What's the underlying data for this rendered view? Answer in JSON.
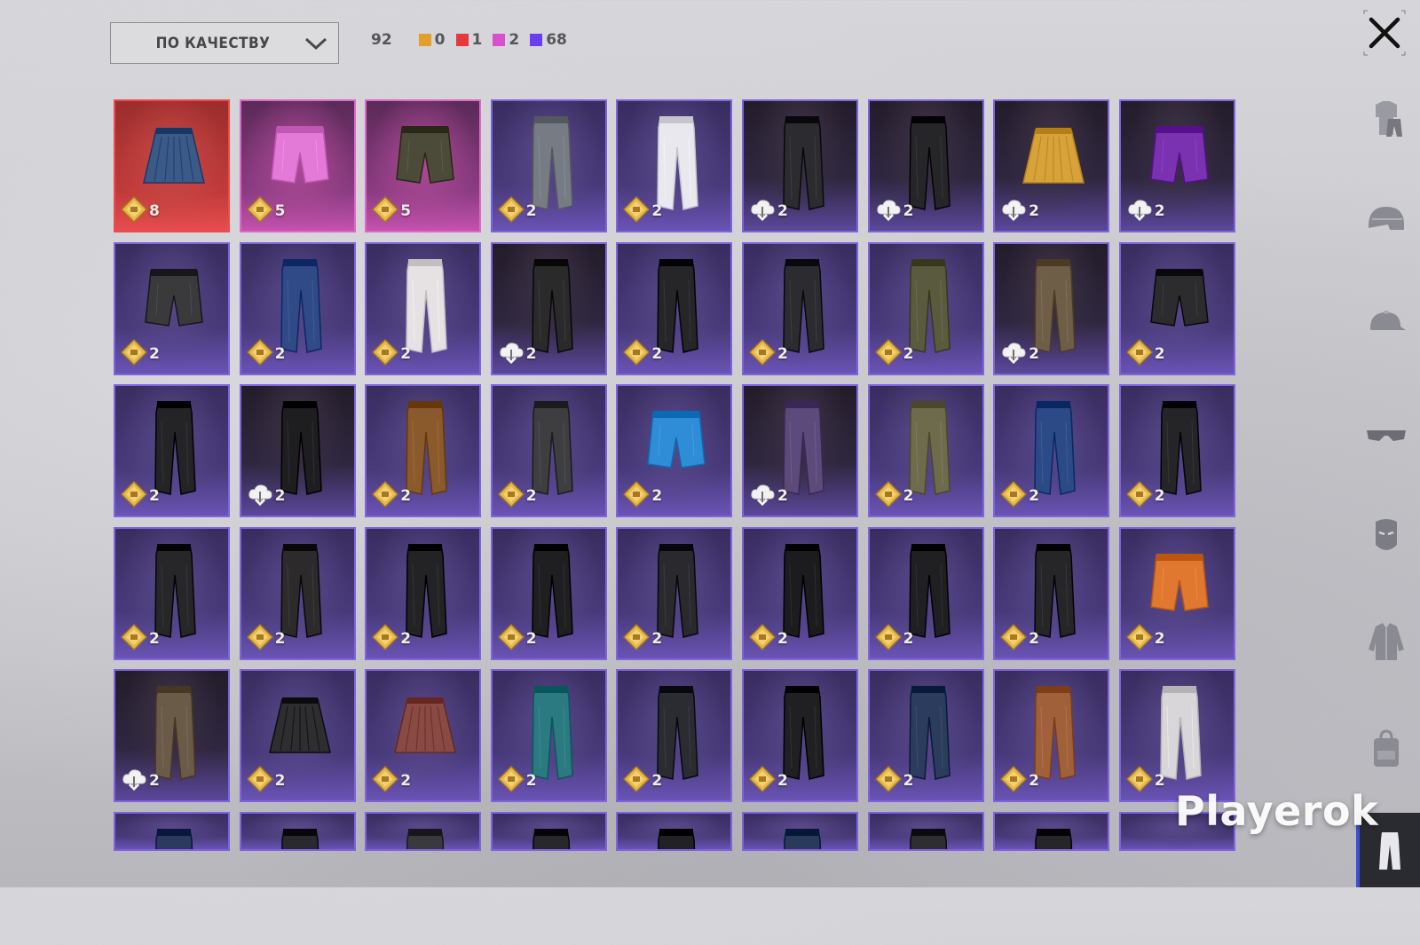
{
  "sort": {
    "label": "ПО КАЧЕСТВУ"
  },
  "counts": {
    "total": "92",
    "groups": [
      {
        "color": "#e0a02a",
        "value": "0"
      },
      {
        "color": "#e8383c",
        "value": "1"
      },
      {
        "color": "#d84fd0",
        "value": "2"
      },
      {
        "color": "#6b3df0",
        "value": "68"
      }
    ]
  },
  "items": [
    {
      "name": "denim-pleated-skirt",
      "tier": "red",
      "icon": "bp-coin",
      "value": "8",
      "kind": "skirt",
      "color": "#3c5a88"
    },
    {
      "name": "pink-shorts",
      "tier": "pink",
      "icon": "bp-coin",
      "value": "5",
      "kind": "shorts",
      "color": "#e47ad8"
    },
    {
      "name": "camo-shorts",
      "tier": "pink",
      "icon": "bp-coin",
      "value": "5",
      "kind": "shorts",
      "color": "#4c4a38"
    },
    {
      "name": "grey-cargo-pants",
      "tier": "purple",
      "icon": "bp-coin",
      "value": "2",
      "kind": "pants",
      "color": "#777b83"
    },
    {
      "name": "white-flared-pants",
      "tier": "purple",
      "icon": "bp-coin",
      "value": "2",
      "kind": "pants",
      "color": "#e8e8ee"
    },
    {
      "name": "dark-strapped-pants",
      "tier": "dark",
      "icon": "cloud-download",
      "value": "2",
      "kind": "pants",
      "color": "#2c2c30"
    },
    {
      "name": "black-moto-pants",
      "tier": "dark",
      "icon": "cloud-download",
      "value": "2",
      "kind": "pants",
      "color": "#262629"
    },
    {
      "name": "yellow-plaid-skirt",
      "tier": "dark",
      "icon": "cloud-download",
      "value": "2",
      "kind": "skirt",
      "color": "#d8a23a"
    },
    {
      "name": "purple-lace-shorts",
      "tier": "dark",
      "icon": "cloud-download",
      "value": "2",
      "kind": "shorts",
      "color": "#7a32b0"
    },
    {
      "name": "black-torn-shorts",
      "tier": "purple",
      "icon": "bp-coin",
      "value": "2",
      "kind": "shorts",
      "color": "#3a3a3c"
    },
    {
      "name": "blue-ripped-jeans",
      "tier": "purple",
      "icon": "bp-coin",
      "value": "2",
      "kind": "pants",
      "color": "#2f4a86"
    },
    {
      "name": "white-patterned-leggings",
      "tier": "purple",
      "icon": "bp-coin",
      "value": "2",
      "kind": "pants",
      "color": "#e6e2e4"
    },
    {
      "name": "black-belt-pants",
      "tier": "dark",
      "icon": "cloud-download",
      "value": "2",
      "kind": "pants",
      "color": "#2a2a2b"
    },
    {
      "name": "black-joggers",
      "tier": "purple",
      "icon": "bp-coin",
      "value": "2",
      "kind": "pants",
      "color": "#262628"
    },
    {
      "name": "red-strap-pants",
      "tier": "purple",
      "icon": "bp-coin",
      "value": "2",
      "kind": "pants",
      "color": "#2b2b30"
    },
    {
      "name": "olive-cargo-pants",
      "tier": "purple",
      "icon": "bp-coin",
      "value": "2",
      "kind": "pants",
      "color": "#5a5a3e"
    },
    {
      "name": "camo-slim-pants",
      "tier": "dark",
      "icon": "cloud-download",
      "value": "2",
      "kind": "pants",
      "color": "#6e5e48"
    },
    {
      "name": "black-shorts-with-boots",
      "tier": "purple",
      "icon": "bp-coin",
      "value": "2",
      "kind": "shorts",
      "color": "#2c2c2e"
    },
    {
      "name": "black-jodhpurs",
      "tier": "purple",
      "icon": "bp-coin",
      "value": "2",
      "kind": "pants",
      "color": "#242426"
    },
    {
      "name": "black-strap-pants",
      "tier": "dark",
      "icon": "cloud-download",
      "value": "2",
      "kind": "pants",
      "color": "#1e1e20"
    },
    {
      "name": "bronze-leather-pants",
      "tier": "purple",
      "icon": "bp-coin",
      "value": "2",
      "kind": "pants",
      "color": "#8a5a2c"
    },
    {
      "name": "digital-camo-pants",
      "tier": "purple",
      "icon": "bp-coin",
      "value": "2",
      "kind": "pants",
      "color": "#3e3e40"
    },
    {
      "name": "blue-yellow-shorts",
      "tier": "purple",
      "icon": "bp-coin",
      "value": "2",
      "kind": "shorts",
      "color": "#2f8cd6"
    },
    {
      "name": "argyle-pants",
      "tier": "dark",
      "icon": "cloud-download",
      "value": "2",
      "kind": "pants",
      "color": "#5c4a7a"
    },
    {
      "name": "khaki-pants",
      "tier": "purple",
      "icon": "bp-coin",
      "value": "2",
      "kind": "pants",
      "color": "#6e6a4c"
    },
    {
      "name": "blue-jeans-pink-wrap",
      "tier": "purple",
      "icon": "bp-coin",
      "value": "2",
      "kind": "pants",
      "color": "#2c4b86"
    },
    {
      "name": "black-graffiti-pants",
      "tier": "purple",
      "icon": "bp-coin",
      "value": "2",
      "kind": "pants",
      "color": "#252527"
    },
    {
      "name": "black-tactical-pants",
      "tier": "purple",
      "icon": "bp-coin",
      "value": "2",
      "kind": "pants",
      "color": "#27272a"
    },
    {
      "name": "black-red-stitch-pants",
      "tier": "purple",
      "icon": "bp-coin",
      "value": "2",
      "kind": "pants",
      "color": "#2d2a2c"
    },
    {
      "name": "black-red-stripe-pants",
      "tier": "purple",
      "icon": "bp-coin",
      "value": "2",
      "kind": "pants",
      "color": "#232326"
    },
    {
      "name": "black-red-belt-pants",
      "tier": "purple",
      "icon": "bp-coin",
      "value": "2",
      "kind": "pants",
      "color": "#1f1f21"
    },
    {
      "name": "black-blue-patch-pants",
      "tier": "purple",
      "icon": "bp-coin",
      "value": "2",
      "kind": "pants",
      "color": "#2a2a2e"
    },
    {
      "name": "black-track-pants",
      "tier": "purple",
      "icon": "bp-coin",
      "value": "2",
      "kind": "pants",
      "color": "#1c1c1e"
    },
    {
      "name": "black-neon-pants",
      "tier": "purple",
      "icon": "bp-coin",
      "value": "2",
      "kind": "pants",
      "color": "#202023"
    },
    {
      "name": "black-asym-pants",
      "tier": "purple",
      "icon": "bp-coin",
      "value": "2",
      "kind": "pants",
      "color": "#262628"
    },
    {
      "name": "orange-floral-shorts",
      "tier": "purple",
      "icon": "bp-coin",
      "value": "2",
      "kind": "shorts",
      "color": "#e07830"
    },
    {
      "name": "two-tone-pants",
      "tier": "dark",
      "icon": "cloud-download",
      "value": "2",
      "kind": "pants",
      "color": "#6a5a48"
    },
    {
      "name": "black-leather-skirt",
      "tier": "purple",
      "icon": "bp-coin",
      "value": "2",
      "kind": "skirt",
      "color": "#2e2e30"
    },
    {
      "name": "red-plaid-skirt",
      "tier": "purple",
      "icon": "bp-coin",
      "value": "2",
      "kind": "skirt",
      "color": "#8a4a44"
    },
    {
      "name": "teal-jeans",
      "tier": "purple",
      "icon": "bp-coin",
      "value": "2",
      "kind": "pants",
      "color": "#2a7a80"
    },
    {
      "name": "dark-biker-jeans",
      "tier": "purple",
      "icon": "bp-coin",
      "value": "2",
      "kind": "pants",
      "color": "#2a2c32"
    },
    {
      "name": "black-zip-pants",
      "tier": "purple",
      "icon": "bp-coin",
      "value": "2",
      "kind": "pants",
      "color": "#202022"
    },
    {
      "name": "blue-orange-jeans",
      "tier": "purple",
      "icon": "bp-coin",
      "value": "2",
      "kind": "pants",
      "color": "#2c3c5c"
    },
    {
      "name": "brown-chaps",
      "tier": "purple",
      "icon": "bp-coin",
      "value": "2",
      "kind": "pants",
      "color": "#a0603a"
    },
    {
      "name": "white-jeans",
      "tier": "purple",
      "icon": "bp-coin",
      "value": "2",
      "kind": "pants",
      "color": "#d8d6d8"
    },
    {
      "name": "partial-blue-jeans",
      "tier": "purple",
      "icon": "",
      "value": "",
      "kind": "pants",
      "color": "#2c3a60"
    },
    {
      "name": "partial-star-pants",
      "tier": "purple",
      "icon": "",
      "value": "",
      "kind": "pants",
      "color": "#2a2a2e"
    },
    {
      "name": "partial-grey-pants",
      "tier": "purple",
      "icon": "",
      "value": "",
      "kind": "pants",
      "color": "#3a3a3e"
    },
    {
      "name": "partial-dark-pants",
      "tier": "purple",
      "icon": "",
      "value": "",
      "kind": "pants",
      "color": "#28282c"
    },
    {
      "name": "partial-black-pants",
      "tier": "purple",
      "icon": "",
      "value": "",
      "kind": "pants",
      "color": "#222224"
    },
    {
      "name": "partial-denim-pants",
      "tier": "purple",
      "icon": "",
      "value": "",
      "kind": "pants",
      "color": "#2a3a5a"
    },
    {
      "name": "partial-charcoal-pants",
      "tier": "purple",
      "icon": "",
      "value": "",
      "kind": "pants",
      "color": "#2e2e32"
    },
    {
      "name": "partial-moto-pants",
      "tier": "purple",
      "icon": "",
      "value": "",
      "kind": "pants",
      "color": "#262628"
    },
    {
      "name": "partial-empty",
      "tier": "purple",
      "icon": "",
      "value": "",
      "kind": "none",
      "color": ""
    }
  ],
  "sidebar": [
    {
      "name": "outfit-icon"
    },
    {
      "name": "helmet-icon"
    },
    {
      "name": "cap-icon"
    },
    {
      "name": "glasses-icon"
    },
    {
      "name": "mask-icon"
    },
    {
      "name": "jacket-icon"
    },
    {
      "name": "backpack-icon"
    },
    {
      "name": "pants-icon",
      "active": true
    }
  ],
  "watermark": "Playerok"
}
